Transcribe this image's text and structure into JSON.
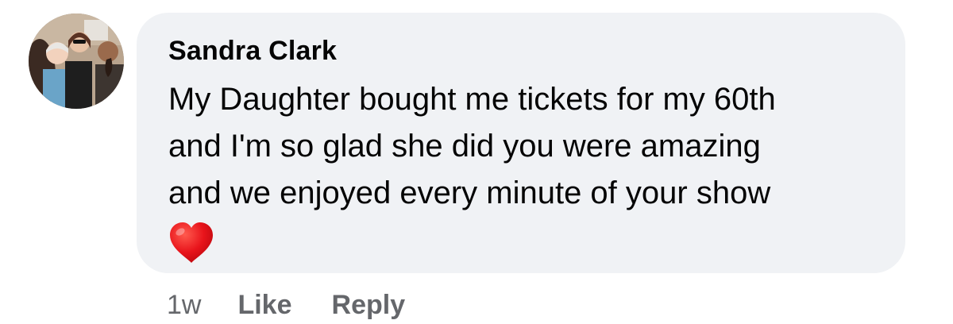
{
  "comment": {
    "author": "Sandra Clark",
    "text_lines": [
      "My Daughter bought me tickets for my 60th",
      "and I'm so glad she did you were amazing",
      "and we enjoyed every minute of your show"
    ],
    "emoji": "red-heart"
  },
  "actions": {
    "timestamp": "1w",
    "like_label": "Like",
    "reply_label": "Reply"
  },
  "colors": {
    "bubble_bg": "#f0f2f5",
    "text": "#050505",
    "meta": "#65676b",
    "heart": "#e8141b"
  }
}
